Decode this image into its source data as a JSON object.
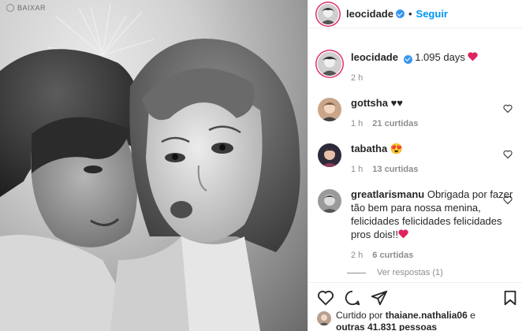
{
  "download_badge": {
    "label": "BAIXAR",
    "icon": "download-icon"
  },
  "header": {
    "username": "leocidade",
    "separator": "•",
    "follow_label": "Seguir"
  },
  "caption": {
    "username": "leocidade",
    "text": "1.095 days",
    "time": "2 h",
    "emoji": "heart"
  },
  "comments": [
    {
      "username": "gottsha",
      "text": "♥♥",
      "time": "1 h",
      "likes": "21 curtidas"
    },
    {
      "username": "tabatha",
      "text": "😍",
      "time": "1 h",
      "likes": "13 curtidas"
    },
    {
      "username": "greatlarismanu",
      "text": "Obrigada por fazer tão bem para nossa menina, felicidades felicidades felicidades pros dois!!",
      "time": "2 h",
      "likes": "6 curtidas",
      "emoji": "heart"
    }
  ],
  "replies_label": "Ver respostas (1)",
  "liked_by": {
    "prefix": "Curtido por",
    "user": "thaiane.nathalia06",
    "suffix": "e",
    "others": "outras 41.831 pessoas"
  },
  "colors": {
    "accent": "#0095f6",
    "heart": "#ed4956",
    "verified": "#3897f0",
    "muted": "#8e8e8e"
  }
}
